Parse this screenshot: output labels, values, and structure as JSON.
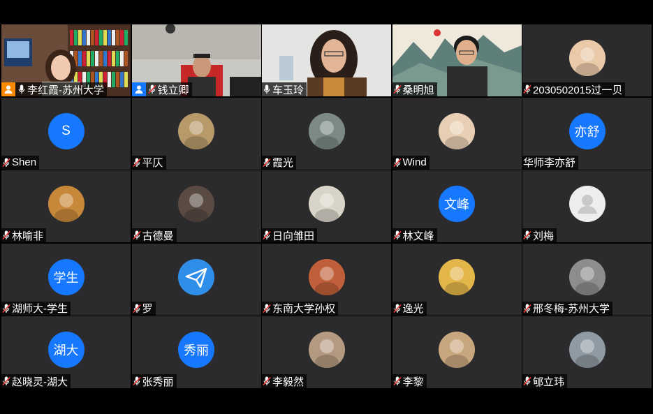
{
  "participants": [
    {
      "name": "李红霞-苏州大学",
      "badge": "host",
      "mic": "on",
      "view": "video",
      "scene": "bookshelf"
    },
    {
      "name": "钱立卿",
      "badge": "cohost",
      "mic": "muted",
      "view": "video",
      "scene": "room"
    },
    {
      "name": "车玉玲",
      "badge": "",
      "mic": "on",
      "view": "video",
      "scene": "woman",
      "active": true
    },
    {
      "name": "桑明旭",
      "badge": "",
      "mic": "muted",
      "view": "video",
      "scene": "landscape"
    },
    {
      "name": "2030502015过一贝",
      "badge": "",
      "mic": "muted",
      "view": "avatar",
      "avatar": "image",
      "color": "#e9c9a8"
    },
    {
      "name": "Shen",
      "mic": "muted",
      "view": "avatar",
      "avatar": "text",
      "text": "S",
      "color": "#1677ff"
    },
    {
      "name": "平仄",
      "mic": "muted",
      "view": "avatar",
      "avatar": "image",
      "color": "#b89a6a"
    },
    {
      "name": "霞光",
      "mic": "muted",
      "view": "avatar",
      "avatar": "image",
      "color": "#7c8a84"
    },
    {
      "name": "Wind",
      "mic": "muted",
      "view": "avatar",
      "avatar": "image",
      "color": "#e8cfb4"
    },
    {
      "name": "华师李亦舒",
      "mic": "",
      "view": "avatar",
      "avatar": "text",
      "text": "亦舒",
      "color": "#1677ff"
    },
    {
      "name": "林喻非",
      "mic": "muted",
      "view": "avatar",
      "avatar": "image",
      "color": "#c8883a"
    },
    {
      "name": "古德曼",
      "mic": "muted",
      "view": "avatar",
      "avatar": "image",
      "color": "#5a4a44"
    },
    {
      "name": "日向雏田",
      "mic": "muted",
      "view": "avatar",
      "avatar": "image",
      "color": "#d9d4c8"
    },
    {
      "name": "林文峰",
      "mic": "muted",
      "view": "avatar",
      "avatar": "text",
      "text": "文峰",
      "color": "#1677ff"
    },
    {
      "name": "刘梅",
      "mic": "muted",
      "view": "avatar",
      "avatar": "default",
      "color": "#eeeeee"
    },
    {
      "name": "湖师大-学生",
      "mic": "muted",
      "view": "avatar",
      "avatar": "text",
      "text": "学生",
      "color": "#1677ff"
    },
    {
      "name": "罗",
      "mic": "muted",
      "view": "avatar",
      "avatar": "plane",
      "color": "#2f8fe8"
    },
    {
      "name": "东南大学孙权",
      "mic": "muted",
      "view": "avatar",
      "avatar": "image",
      "color": "#c0603a"
    },
    {
      "name": "逸光",
      "mic": "muted",
      "view": "avatar",
      "avatar": "image",
      "color": "#e3b64a"
    },
    {
      "name": "邢冬梅-苏州大学",
      "mic": "muted",
      "view": "avatar",
      "avatar": "image",
      "color": "#8d8d8d"
    },
    {
      "name": "赵晓灵-湖大",
      "mic": "muted",
      "view": "avatar",
      "avatar": "text",
      "text": "湖大",
      "color": "#1677ff"
    },
    {
      "name": "张秀丽",
      "mic": "muted",
      "view": "avatar",
      "avatar": "text",
      "text": "秀丽",
      "color": "#1677ff"
    },
    {
      "name": "李毅然",
      "mic": "muted",
      "view": "avatar",
      "avatar": "image",
      "color": "#b59a82"
    },
    {
      "name": "李黎",
      "mic": "muted",
      "view": "avatar",
      "avatar": "image",
      "color": "#c9a77e"
    },
    {
      "name": "郇立玮",
      "mic": "muted",
      "view": "avatar",
      "avatar": "image",
      "color": "#8f9aa3"
    }
  ]
}
